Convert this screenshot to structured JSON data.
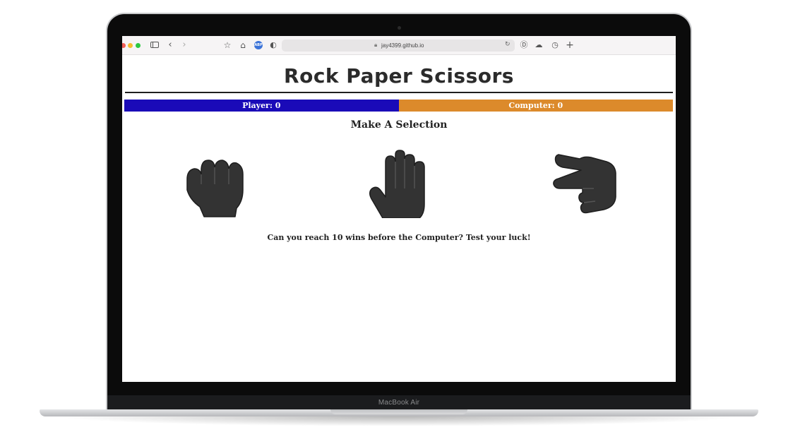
{
  "device": {
    "model_label": "MacBook Air"
  },
  "browser": {
    "url": "jay4399.github.io",
    "icons": [
      "sidebar-icon",
      "back-icon",
      "forward-icon",
      "star-icon",
      "home-icon",
      "adblock-icon",
      "shield-icon",
      "lock-icon",
      "reload-icon",
      "download-icon",
      "cloud-icon",
      "clock-icon",
      "plus-icon"
    ],
    "abp_label": "ABP"
  },
  "game": {
    "title": "Rock Paper Scissors",
    "player_score_label": "Player: 0",
    "computer_score_label": "Computer: 0",
    "selection_heading": "Make A Selection",
    "choices": [
      "rock-icon",
      "paper-icon",
      "scissors-icon"
    ],
    "message": "Can you reach 10 wins before the Computer? Test your luck!"
  },
  "colors": {
    "player_bar": "#1a0ab8",
    "computer_bar": "#dc8a2b",
    "icon_fill": "#333333"
  }
}
